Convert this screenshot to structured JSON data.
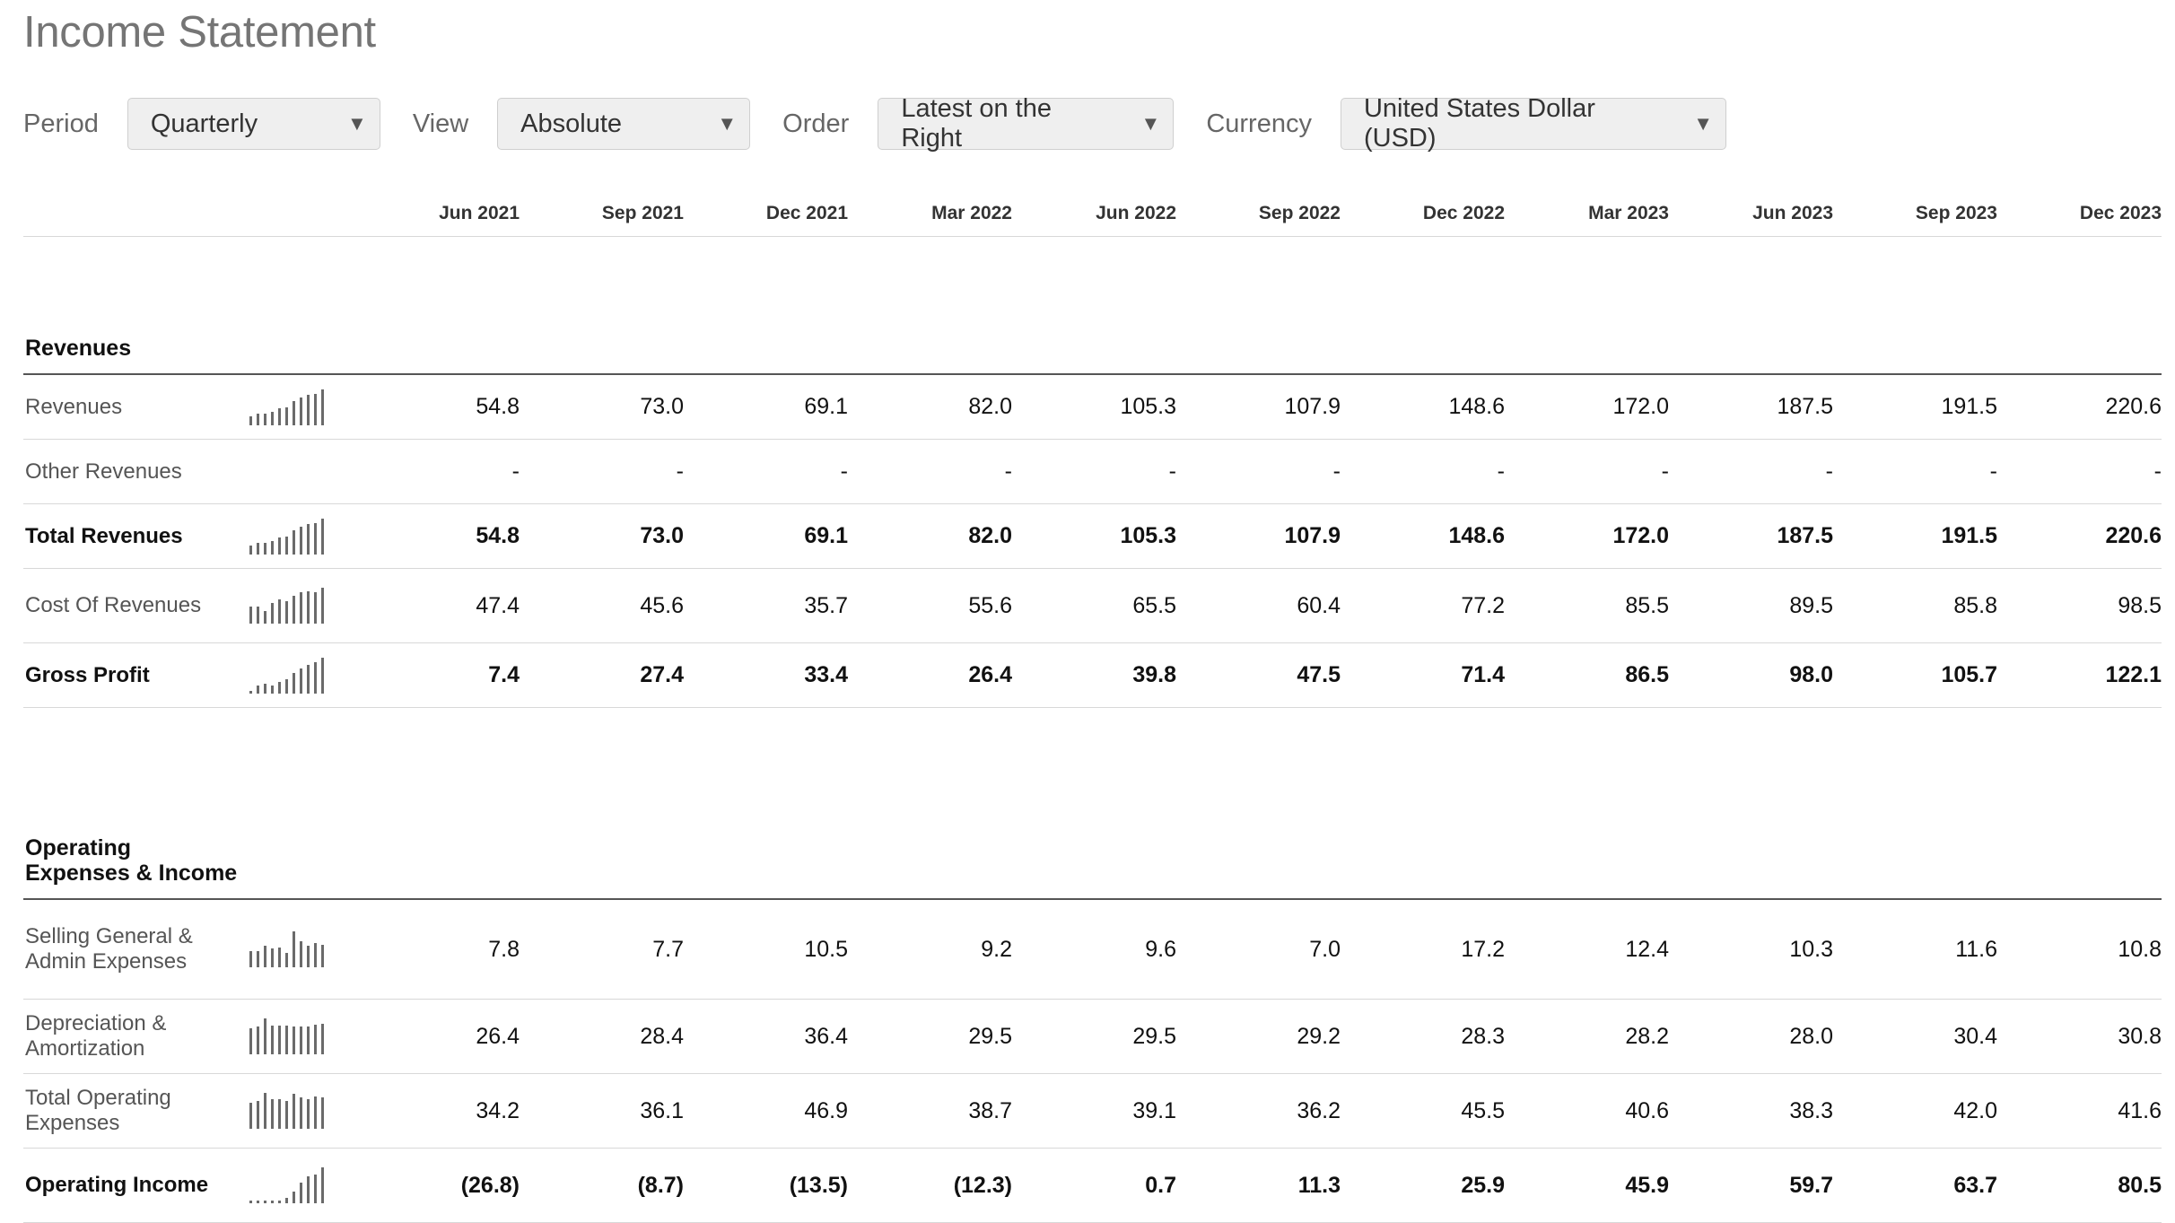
{
  "page": {
    "title": "Income Statement"
  },
  "filters": [
    {
      "label": "Period",
      "value": "Quarterly"
    },
    {
      "label": "View",
      "value": "Absolute"
    },
    {
      "label": "Order",
      "value": "Latest on the Right"
    },
    {
      "label": "Currency",
      "value": "United States Dollar (USD)"
    }
  ],
  "columns": [
    "Jun 2021",
    "Sep 2021",
    "Dec 2021",
    "Mar 2022",
    "Jun 2022",
    "Sep 2022",
    "Dec 2022",
    "Mar 2023",
    "Jun 2023",
    "Sep 2023",
    "Dec 2023"
  ],
  "sections": [
    {
      "title": "Revenues",
      "rows": [
        {
          "label": "Revenues",
          "bold": false,
          "spark": true,
          "values": [
            "54.8",
            "73.0",
            "69.1",
            "82.0",
            "105.3",
            "107.9",
            "148.6",
            "172.0",
            "187.5",
            "191.5",
            "220.6"
          ]
        },
        {
          "label": "Other Revenues",
          "bold": false,
          "spark": false,
          "values": [
            "-",
            "-",
            "-",
            "-",
            "-",
            "-",
            "-",
            "-",
            "-",
            "-",
            "-"
          ]
        },
        {
          "label": "Total Revenues",
          "bold": true,
          "spark": true,
          "values": [
            "54.8",
            "73.0",
            "69.1",
            "82.0",
            "105.3",
            "107.9",
            "148.6",
            "172.0",
            "187.5",
            "191.5",
            "220.6"
          ]
        },
        {
          "label": "Cost Of Revenues",
          "bold": false,
          "spark": true,
          "values": [
            "47.4",
            "45.6",
            "35.7",
            "55.6",
            "65.5",
            "60.4",
            "77.2",
            "85.5",
            "89.5",
            "85.8",
            "98.5"
          ]
        },
        {
          "label": "Gross Profit",
          "bold": true,
          "spark": true,
          "values": [
            "7.4",
            "27.4",
            "33.4",
            "26.4",
            "39.8",
            "47.5",
            "71.4",
            "86.5",
            "98.0",
            "105.7",
            "122.1"
          ]
        }
      ]
    },
    {
      "title": "Operating Expenses & Income",
      "rows": [
        {
          "label": "Selling General & Admin Expenses",
          "bold": false,
          "spark": true,
          "values": [
            "7.8",
            "7.7",
            "10.5",
            "9.2",
            "9.6",
            "7.0",
            "17.2",
            "12.4",
            "10.3",
            "11.6",
            "10.8"
          ]
        },
        {
          "label": "Depreciation & Amortization",
          "bold": false,
          "spark": true,
          "values": [
            "26.4",
            "28.4",
            "36.4",
            "29.5",
            "29.5",
            "29.2",
            "28.3",
            "28.2",
            "28.0",
            "30.4",
            "30.8"
          ]
        },
        {
          "label": "Total Operating Expenses",
          "bold": false,
          "spark": true,
          "values": [
            "34.2",
            "36.1",
            "46.9",
            "38.7",
            "39.1",
            "36.2",
            "45.5",
            "40.6",
            "38.3",
            "42.0",
            "41.6"
          ]
        },
        {
          "label": "Operating Income",
          "bold": true,
          "spark": true,
          "values": [
            "(26.8)",
            "(8.7)",
            "(13.5)",
            "(12.3)",
            "0.7",
            "11.3",
            "25.9",
            "45.9",
            "59.7",
            "63.7",
            "80.5"
          ]
        }
      ]
    }
  ]
}
